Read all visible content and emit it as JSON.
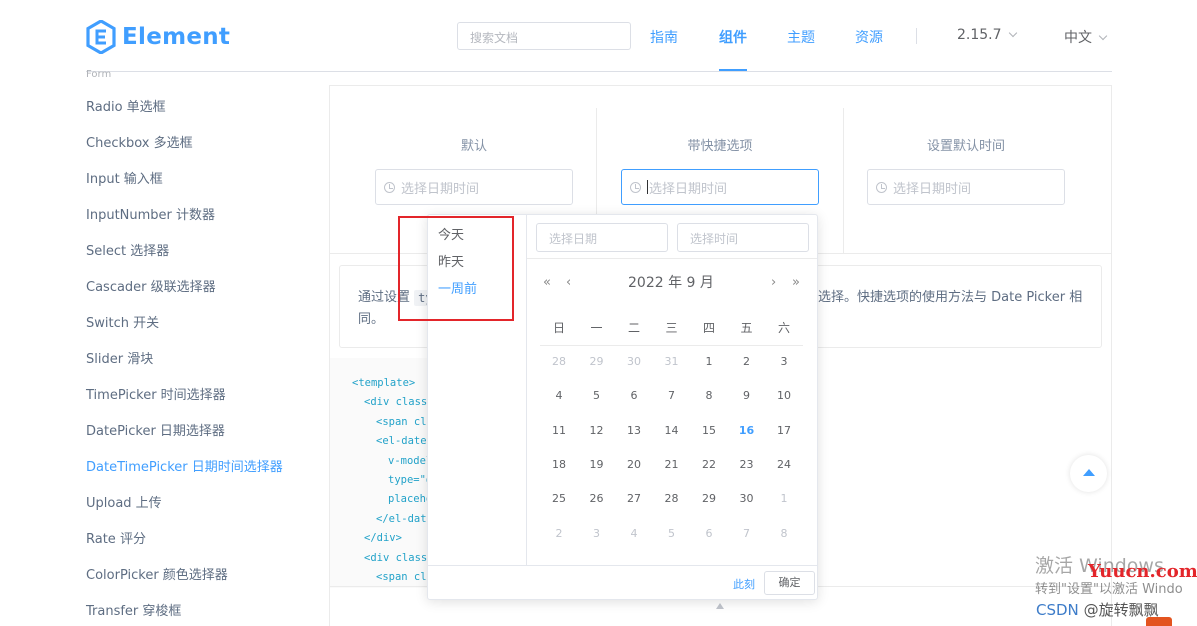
{
  "header": {
    "logo_text": "Element",
    "search_placeholder": "搜索文档",
    "nav": [
      "指南",
      "组件",
      "主题",
      "资源"
    ],
    "version": "2.15.7",
    "language": "中文"
  },
  "sidebar": {
    "group": "Form",
    "items": [
      "Radio 单选框",
      "Checkbox 多选框",
      "Input 输入框",
      "InputNumber 计数器",
      "Select 选择器",
      "Cascader 级联选择器",
      "Switch 开关",
      "Slider 滑块",
      "TimePicker 时间选择器",
      "DatePicker 日期选择器",
      "DateTimePicker 日期时间选择器",
      "Upload 上传",
      "Rate 评分",
      "ColorPicker 颜色选择器",
      "Transfer 穿梭框"
    ],
    "active_index": 10
  },
  "demo": {
    "columns": [
      "默认",
      "带快捷选项",
      "设置默认时间"
    ],
    "input_placeholder": "选择日期时间"
  },
  "description": {
    "prefix": "通过设置",
    "code": "type=\"datetime\"",
    "suffix": "选择。快捷选项的使用方法与 Date Picker 相",
    "line2": "同。"
  },
  "code_lines": [
    "<template>",
    "<div class=",
    "<span cla",
    "<el-date-",
    "v-model",
    "type=\"d",
    "placeho",
    "</el-date",
    "</div>",
    "<div class=",
    "<span cla"
  ],
  "picker": {
    "shortcuts": [
      "今天",
      "昨天",
      "一周前"
    ],
    "date_placeholder": "选择日期",
    "time_placeholder": "选择时间",
    "title": "2022 年  9 月",
    "prev_year": "«",
    "prev_month": "‹",
    "next_month": "›",
    "next_year": "»",
    "weekdays": [
      "日",
      "一",
      "二",
      "三",
      "四",
      "五",
      "六"
    ],
    "days": [
      [
        "28",
        "29",
        "30",
        "31",
        "1",
        "2",
        "3"
      ],
      [
        "4",
        "5",
        "6",
        "7",
        "8",
        "9",
        "10"
      ],
      [
        "11",
        "12",
        "13",
        "14",
        "15",
        "16",
        "17"
      ],
      [
        "18",
        "19",
        "20",
        "21",
        "22",
        "23",
        "24"
      ],
      [
        "25",
        "26",
        "27",
        "28",
        "29",
        "30",
        "1"
      ],
      [
        "2",
        "3",
        "4",
        "5",
        "6",
        "7",
        "8"
      ]
    ],
    "today": "16",
    "now_label": "此刻",
    "confirm_label": "确定"
  },
  "overlay": {
    "site": "Yuucn.com",
    "windows_line1": "激活 Windows",
    "windows_line2": "转到\"设置\"以激活 Windo",
    "csdn_prefix": "CSDN",
    "csdn_author": "@旋转飘飘"
  }
}
